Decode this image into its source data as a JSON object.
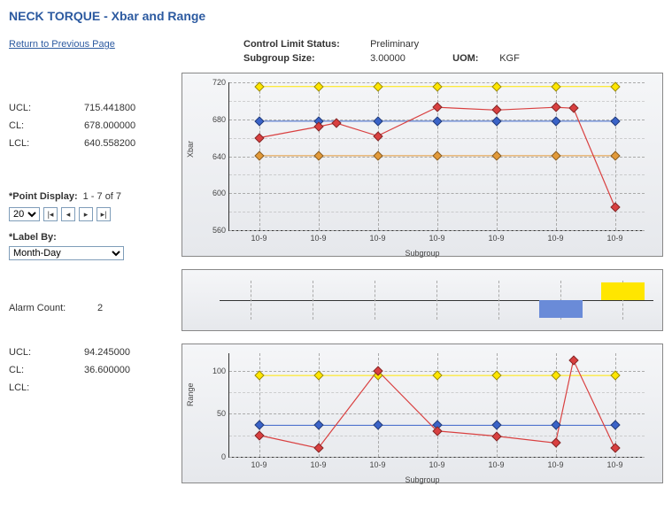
{
  "title": "NECK TORQUE - Xbar and Range",
  "return_link": "Return to Previous Page",
  "header": {
    "control_status_label": "Control Limit Status:",
    "control_status_value": "Preliminary",
    "subgroup_size_label": "Subgroup Size:",
    "subgroup_size_value": "3.00000",
    "uom_label": "UOM:",
    "uom_value": "KGF"
  },
  "xbar_limits": {
    "ucl_label": "UCL:",
    "ucl_value": "715.441800",
    "cl_label": "CL:",
    "cl_value": "678.000000",
    "lcl_label": "LCL:",
    "lcl_value": "640.558200"
  },
  "range_limits": {
    "ucl_label": "UCL:",
    "ucl_value": "94.245000",
    "cl_label": "CL:",
    "cl_value": "36.600000",
    "lcl_label": "LCL:",
    "lcl_value": ""
  },
  "point_display": {
    "label": "*Point Display:",
    "range": "1 - 7 of 7",
    "page_size": "20"
  },
  "label_by": {
    "label": "*Label By:",
    "value": "Month-Day"
  },
  "alarm": {
    "label": "Alarm Count:",
    "value": "2"
  },
  "chart_data": [
    {
      "type": "line",
      "title": "Xbar",
      "xlabel": "Subgroup",
      "ylabel": "Xbar",
      "ylim": [
        560,
        720
      ],
      "yticks": [
        560,
        600,
        640,
        680,
        720
      ],
      "categories": [
        "10-9",
        "10-9",
        "10-9",
        "10-9",
        "10-9",
        "10-9",
        "10-9"
      ],
      "series": [
        {
          "name": "UCL",
          "color": "#ffe600",
          "values": [
            715.4,
            715.4,
            715.4,
            715.4,
            715.4,
            715.4,
            715.4
          ]
        },
        {
          "name": "CL",
          "color": "#3a63c8",
          "values": [
            678,
            678,
            678,
            678,
            678,
            678,
            678
          ]
        },
        {
          "name": "LCL",
          "color": "#e29a3a",
          "values": [
            640.6,
            640.6,
            640.6,
            640.6,
            640.6,
            640.6,
            640.6
          ]
        },
        {
          "name": "Xbar",
          "color": "#d94040",
          "values": [
            660,
            672,
            676,
            662,
            693,
            690,
            693,
            692,
            585
          ]
        }
      ],
      "xbar_x_offsets": [
        0,
        1,
        1.3,
        2,
        3,
        4,
        5,
        5.3,
        6
      ]
    },
    {
      "type": "bar",
      "title": "Alarm",
      "categories": [
        "10-9",
        "10-9",
        "10-9",
        "10-9",
        "10-9",
        "10-9",
        "10-9"
      ],
      "values": [
        0,
        0,
        0,
        0,
        0,
        -1,
        1
      ]
    },
    {
      "type": "line",
      "title": "Range",
      "xlabel": "Subgroup",
      "ylabel": "Range",
      "ylim": [
        0,
        120
      ],
      "yticks": [
        0,
        50,
        100
      ],
      "categories": [
        "10-9",
        "10-9",
        "10-9",
        "10-9",
        "10-9",
        "10-9",
        "10-9"
      ],
      "series": [
        {
          "name": "UCL",
          "color": "#ffe600",
          "values": [
            94.2,
            94.2,
            94.2,
            94.2,
            94.2,
            94.2,
            94.2
          ]
        },
        {
          "name": "CL",
          "color": "#3a63c8",
          "values": [
            36.6,
            36.6,
            36.6,
            36.6,
            36.6,
            36.6,
            36.6
          ]
        },
        {
          "name": "Range",
          "color": "#d94040",
          "values": [
            25,
            10,
            100,
            30,
            24,
            16,
            112,
            10
          ]
        }
      ],
      "range_x_offsets": [
        0,
        1,
        2,
        3,
        4,
        5,
        5.3,
        6
      ]
    }
  ]
}
